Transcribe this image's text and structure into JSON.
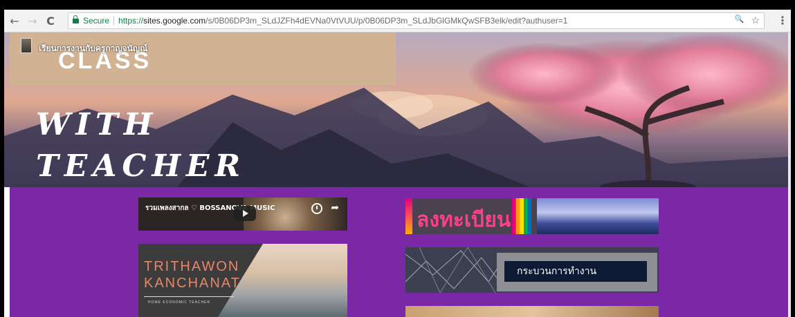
{
  "browser": {
    "back_icon": "←",
    "forward_icon": "→",
    "reload_icon": "C",
    "secure_label": "Secure",
    "url_protocol": "https://",
    "url_host": "sites.google.com",
    "url_path": "/s/0B06DP3m_SLdJZFh4dEVNa0VtVUU/p/0B06DP3m_SLdJbGlGMkQwSFB3elk/edit?authuser=1",
    "zoom_icon": "🔍",
    "star_icon": "☆",
    "menu_icon": "⋮"
  },
  "header": {
    "site_title": "เรียนการงานกับครูกาญจนัญณ์",
    "class_text": "CLASS",
    "with_text": "WITH",
    "teacher_text": "TEACHER"
  },
  "content": {
    "video_title": "รวมเพลงสากล ♡ BOSSANOVA MUSIC",
    "share_icon": "➦",
    "trithawon_line1": "TRITHAWON",
    "trithawon_line2": "KANCHANAT",
    "trithawon_sub": "HOME ECONOMIC TEACHER",
    "register_text": "ลงทะเบียน",
    "process_text": "กระบวนการทำงาน"
  }
}
